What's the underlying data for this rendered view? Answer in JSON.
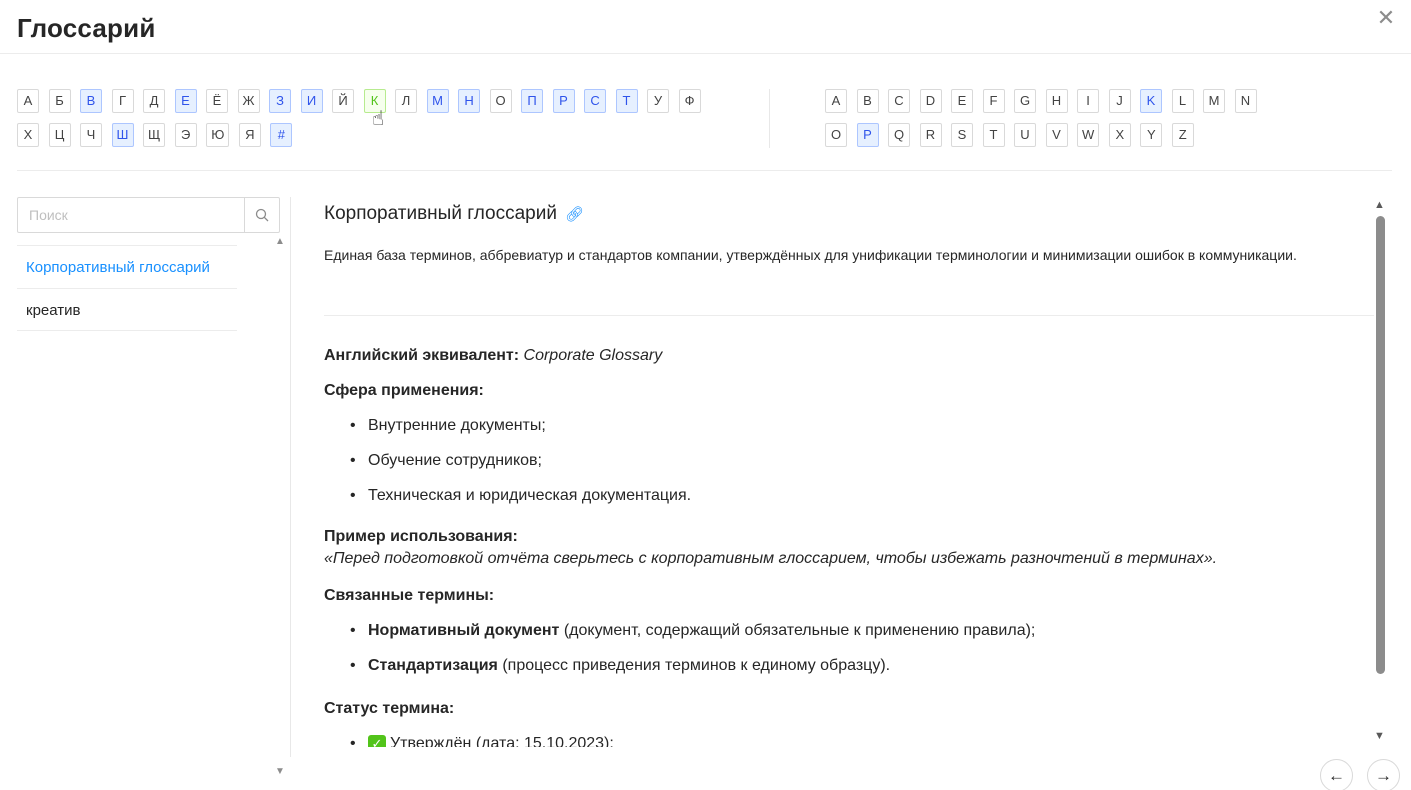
{
  "dialog": {
    "title": "Глоссарий",
    "close_icon": "close-icon"
  },
  "alphabet_ru": [
    [
      "А",
      "Б",
      "В",
      "Г",
      "Д",
      "Е",
      "Ё",
      "Ж",
      "З",
      "И",
      "Й",
      "К",
      "Л",
      "М",
      "Н",
      "О",
      "П",
      "Р",
      "С",
      "Т",
      "У",
      "Ф"
    ],
    [
      "Х",
      "Ц",
      "Ч",
      "Ш",
      "Щ",
      "Э",
      "Ю",
      "Я",
      "#"
    ]
  ],
  "alphabet_ru_active": [
    "В",
    "Е",
    "З",
    "И",
    "М",
    "Н",
    "П",
    "Р",
    "С",
    "Т",
    "Ш",
    "#"
  ],
  "alphabet_ru_hover": "К",
  "alphabet_en": [
    [
      "A",
      "B",
      "C",
      "D",
      "E",
      "F",
      "G",
      "H",
      "I",
      "J",
      "K",
      "L",
      "M",
      "N"
    ],
    [
      "O",
      "P",
      "Q",
      "R",
      "S",
      "T",
      "U",
      "V",
      "W",
      "X",
      "Y",
      "Z"
    ]
  ],
  "alphabet_en_active": [
    "K",
    "P"
  ],
  "search": {
    "placeholder": "Поиск",
    "icon": "search-icon"
  },
  "terms": [
    {
      "label": "Корпоративный глоссарий",
      "selected": true
    },
    {
      "label": "креатив",
      "selected": false
    }
  ],
  "article": {
    "title": "Корпоративный глоссарий",
    "link_icon": "link-icon",
    "description": "Единая база терминов, аббревиатур и стандартов компании, утверждённых для унификации терминологии и минимизации ошибок в коммуникации.",
    "english_label": "Английский эквивалент:",
    "english_value": "Corporate Glossary",
    "scope_label": "Сфера применения:",
    "scope_items": [
      "Внутренние документы;",
      "Обучение сотрудников;",
      "Техническая и юридическая документация."
    ],
    "example_label": "Пример использования:",
    "example_text": "«Перед подготовкой отчёта сверьтесь с корпоративным глоссарием, чтобы избежать разночтений в терминах».",
    "related_label": "Связанные термины:",
    "related_items": [
      {
        "term": "Нормативный документ",
        "note": "(документ, содержащий обязательные к применению правила);"
      },
      {
        "term": "Стандартизация",
        "note": "(процесс приведения терминов к единому образцу)."
      }
    ],
    "status_label": "Статус термина:",
    "status_item": "Утверждён (дата: 15.10.2023);"
  },
  "colors": {
    "accent": "#1890ff",
    "active_bg": "#e6f0ff",
    "hover_bg": "#f6ffed",
    "hover_text": "#52c41a"
  }
}
